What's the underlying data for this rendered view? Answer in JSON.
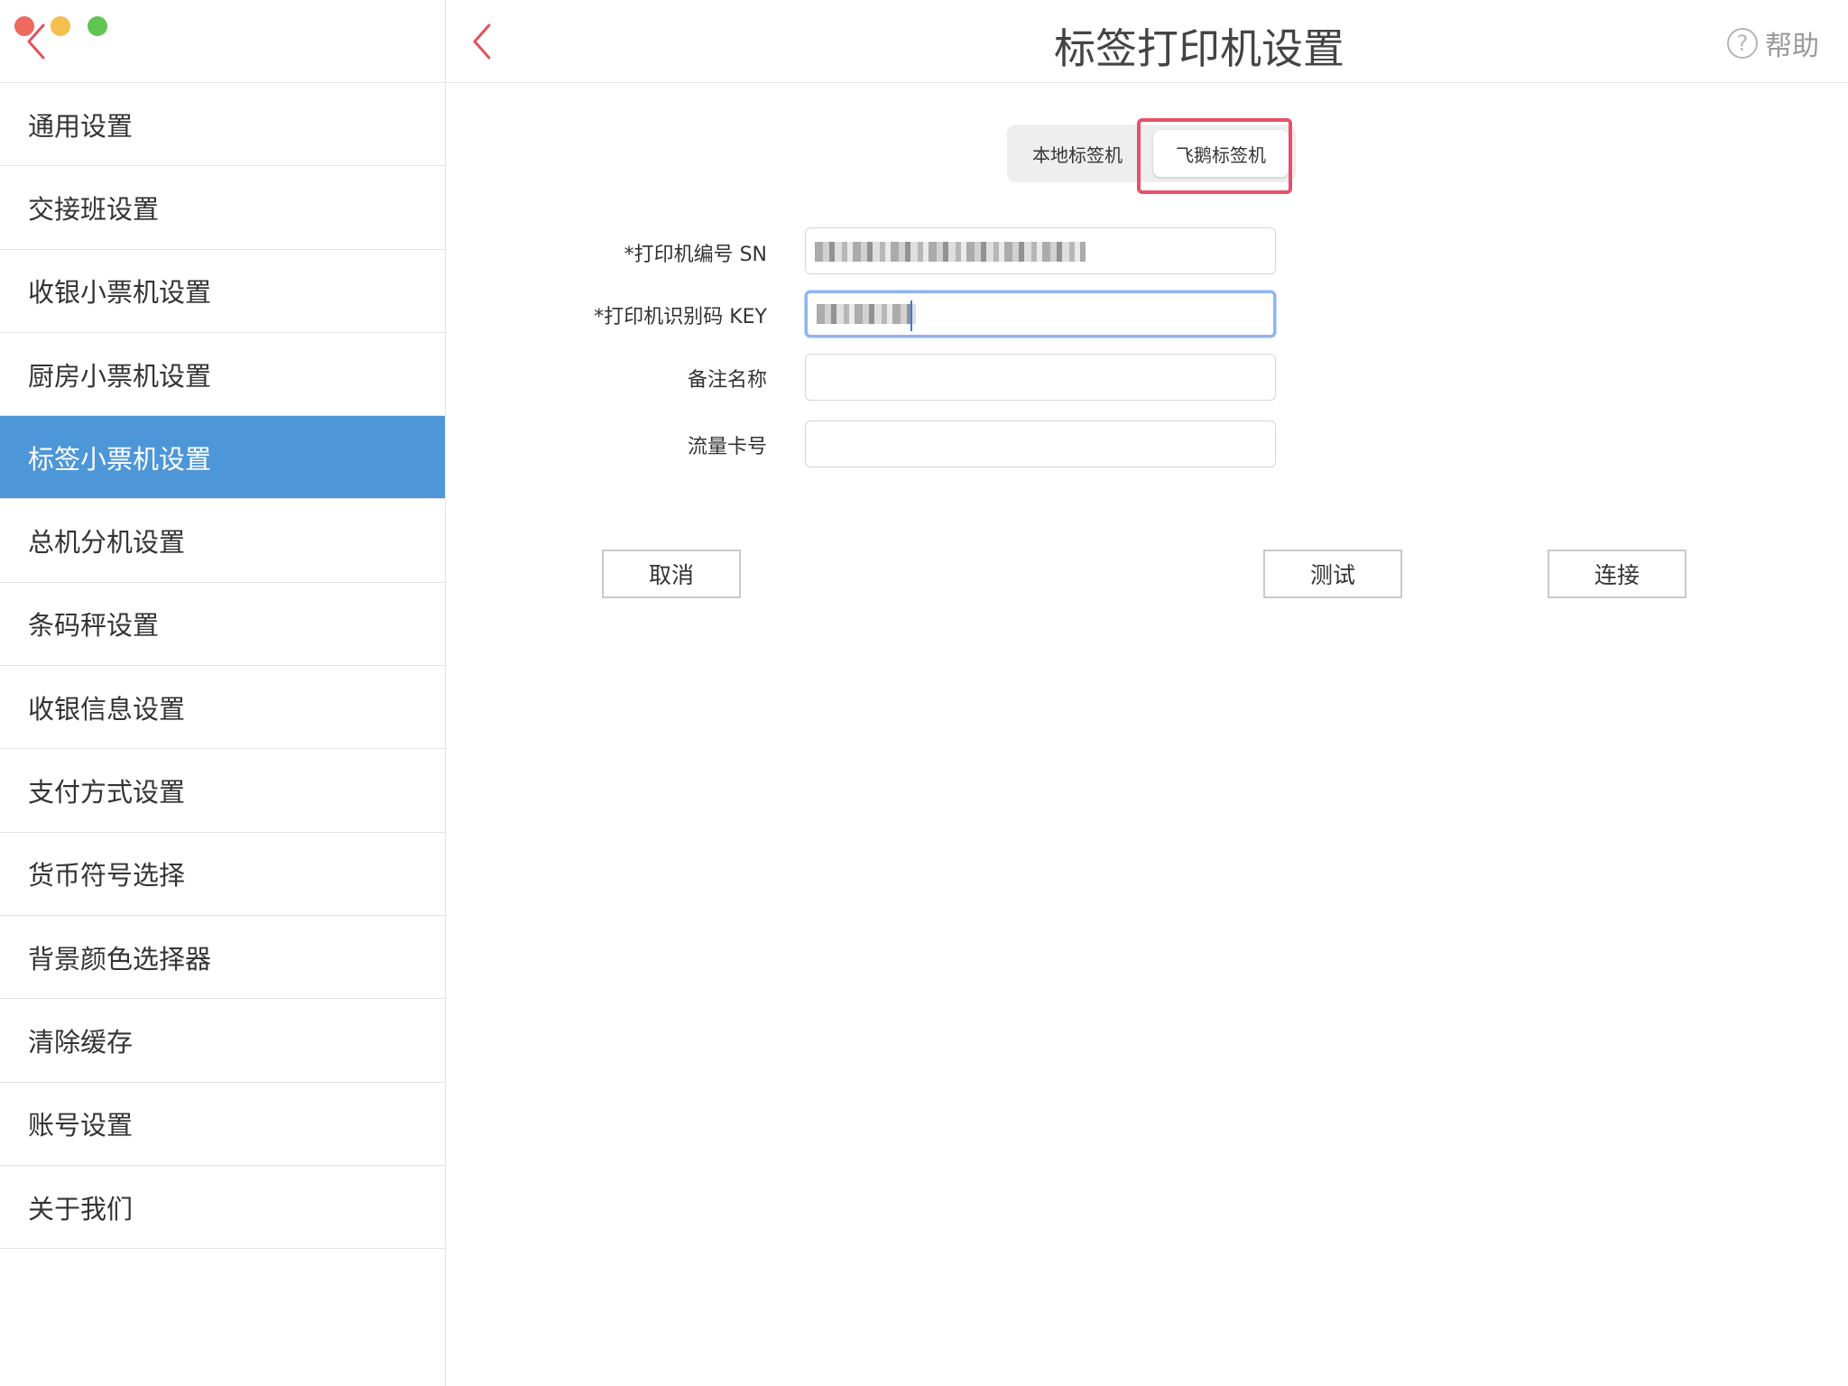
{
  "window": {
    "colors": {
      "accent": "#4d97d8",
      "highlight_border": "#e8506a",
      "traffic_red": "#ec6a5e",
      "traffic_yellow": "#f4bf4f",
      "traffic_green": "#61c554"
    }
  },
  "sidebar": {
    "back_icon": "chevron-left-icon",
    "items": [
      {
        "label": "通用设置",
        "active": false
      },
      {
        "label": "交接班设置",
        "active": false
      },
      {
        "label": "收银小票机设置",
        "active": false
      },
      {
        "label": "厨房小票机设置",
        "active": false
      },
      {
        "label": "标签小票机设置",
        "active": true
      },
      {
        "label": "总机分机设置",
        "active": false
      },
      {
        "label": "条码秤设置",
        "active": false
      },
      {
        "label": "收银信息设置",
        "active": false
      },
      {
        "label": "支付方式设置",
        "active": false
      },
      {
        "label": "货币符号选择",
        "active": false
      },
      {
        "label": "背景颜色选择器",
        "active": false
      },
      {
        "label": "清除缓存",
        "active": false
      },
      {
        "label": "账号设置",
        "active": false
      },
      {
        "label": "关于我们",
        "active": false
      }
    ]
  },
  "header": {
    "title": "标签打印机设置",
    "back_icon": "chevron-left-icon",
    "help_label": "帮助",
    "help_icon": "question-circle-icon"
  },
  "segmented": {
    "local_label": "本地标签机",
    "feie_label": "飞鹅标签机",
    "selected": "飞鹅标签机"
  },
  "form": {
    "sn_label": "*打印机编号 SN",
    "sn_value": "",
    "key_label": "*打印机识别码 KEY",
    "key_value": "",
    "remark_label": "备注名称",
    "remark_value": "",
    "sim_label": "流量卡号",
    "sim_value": ""
  },
  "buttons": {
    "cancel": "取消",
    "test": "测试",
    "connect": "连接"
  }
}
